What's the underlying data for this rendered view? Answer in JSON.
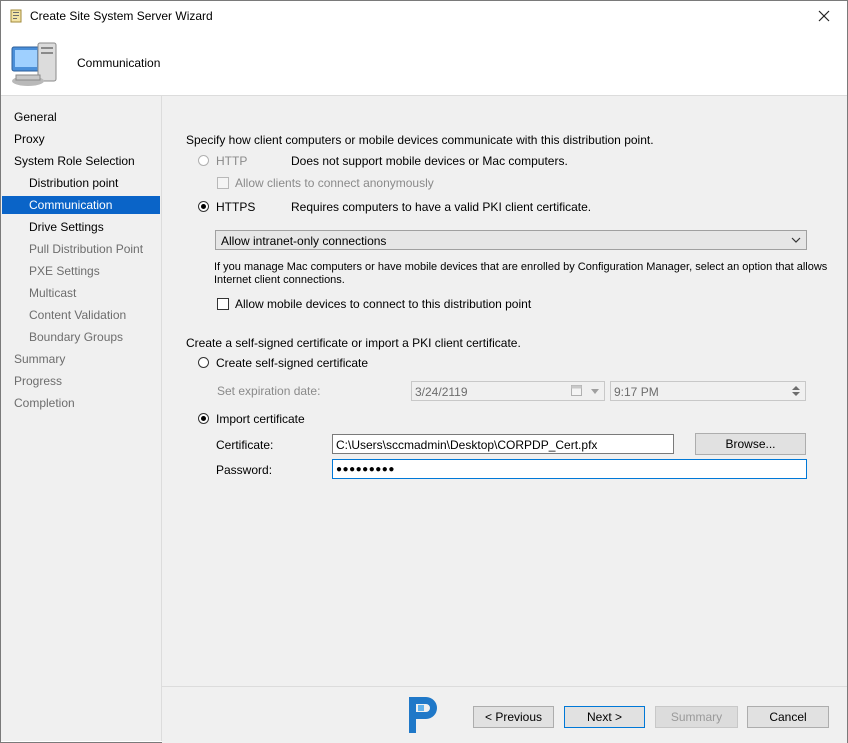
{
  "window": {
    "title": "Create Site System Server Wizard"
  },
  "header": {
    "title": "Communication"
  },
  "sidebar": {
    "items": [
      {
        "label": "General"
      },
      {
        "label": "Proxy"
      },
      {
        "label": "System Role Selection"
      },
      {
        "label": "Distribution point"
      },
      {
        "label": "Communication"
      },
      {
        "label": "Drive Settings"
      },
      {
        "label": "Pull Distribution Point"
      },
      {
        "label": "PXE Settings"
      },
      {
        "label": "Multicast"
      },
      {
        "label": "Content Validation"
      },
      {
        "label": "Boundary Groups"
      },
      {
        "label": "Summary"
      },
      {
        "label": "Progress"
      },
      {
        "label": "Completion"
      }
    ]
  },
  "main": {
    "intro": "Specify how client computers or mobile devices communicate with this distribution point.",
    "http": {
      "label": "HTTP",
      "desc": "Does not support mobile devices or Mac computers."
    },
    "anon_checkbox": "Allow clients to connect anonymously",
    "https": {
      "label": "HTTPS",
      "desc": "Requires computers to have a valid PKI client certificate."
    },
    "connection_select": {
      "value": "Allow intranet-only connections"
    },
    "mac_note_line1": "If you manage Mac computers or have mobile devices that are enrolled by Configuration Manager, select an option that allows",
    "mac_note_line2": "Internet client connections.",
    "mobile_checkbox": "Allow mobile devices to connect to this distribution point",
    "cert_intro": "Create a self-signed certificate or import a PKI client certificate.",
    "self_signed_label": "Create self-signed certificate",
    "expiration_label": "Set expiration date:",
    "expiration_date": "3/24/2119",
    "expiration_time": "9:17 PM",
    "import_label": "Import certificate",
    "certificate_label": "Certificate:",
    "certificate_value": "C:\\Users\\sccmadmin\\Desktop\\CORPDP_Cert.pfx",
    "browse_label": "Browse...",
    "password_label": "Password:",
    "password_value": "●●●●●●●●●"
  },
  "footer": {
    "previous_label": "< Previous",
    "next_label": "Next >",
    "summary_label": "Summary",
    "cancel_label": "Cancel"
  },
  "colors": {
    "selection": "#0a64c8",
    "accent": "#0078d7"
  },
  "icons": [
    "wizard-app-icon",
    "close-icon",
    "computer-icon",
    "calendar-icon",
    "dropdown-arrow-icon",
    "spinner-icon",
    "brand-logo-icon"
  ]
}
